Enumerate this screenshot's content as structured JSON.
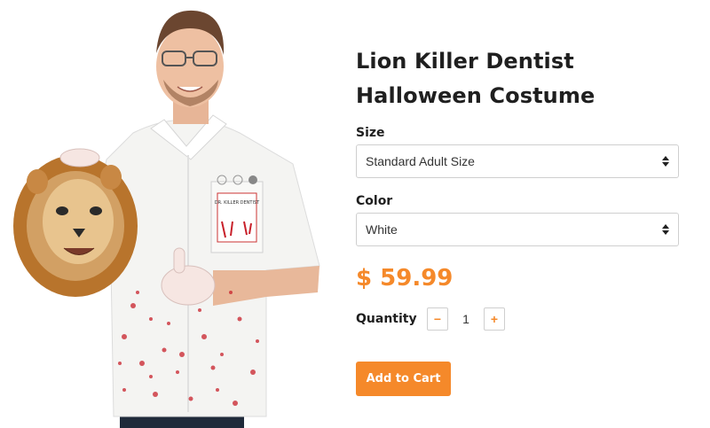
{
  "product": {
    "title": "Lion Killer Dentist Halloween Costume",
    "price": "$ 59.99",
    "image_alt": "Man wearing blood-spattered dentist coat holding a lion head",
    "pocket_text": "DR. KILLER DENTIST"
  },
  "size": {
    "label": "Size",
    "selected": "Standard Adult Size"
  },
  "color": {
    "label": "Color",
    "selected": "White"
  },
  "quantity": {
    "label": "Quantity",
    "value": "1",
    "decrement": "−",
    "increment": "+"
  },
  "cart": {
    "add_label": "Add to Cart"
  },
  "colors": {
    "accent": "#f5892a",
    "border": "#cfcfcf",
    "text": "#1f1f1f"
  }
}
